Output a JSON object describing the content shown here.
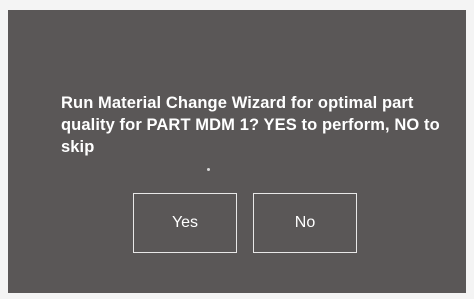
{
  "dialog": {
    "message": "Run Material Change Wizard for optimal part quality for PART MDM 1? YES to perform, NO to skip",
    "buttons": {
      "yes_label": "Yes",
      "no_label": "No"
    }
  },
  "colors": {
    "dialog_background": "#5a5757",
    "page_background": "#f4f4f4",
    "text": "#ffffff",
    "button_border": "#e8e8e8"
  }
}
